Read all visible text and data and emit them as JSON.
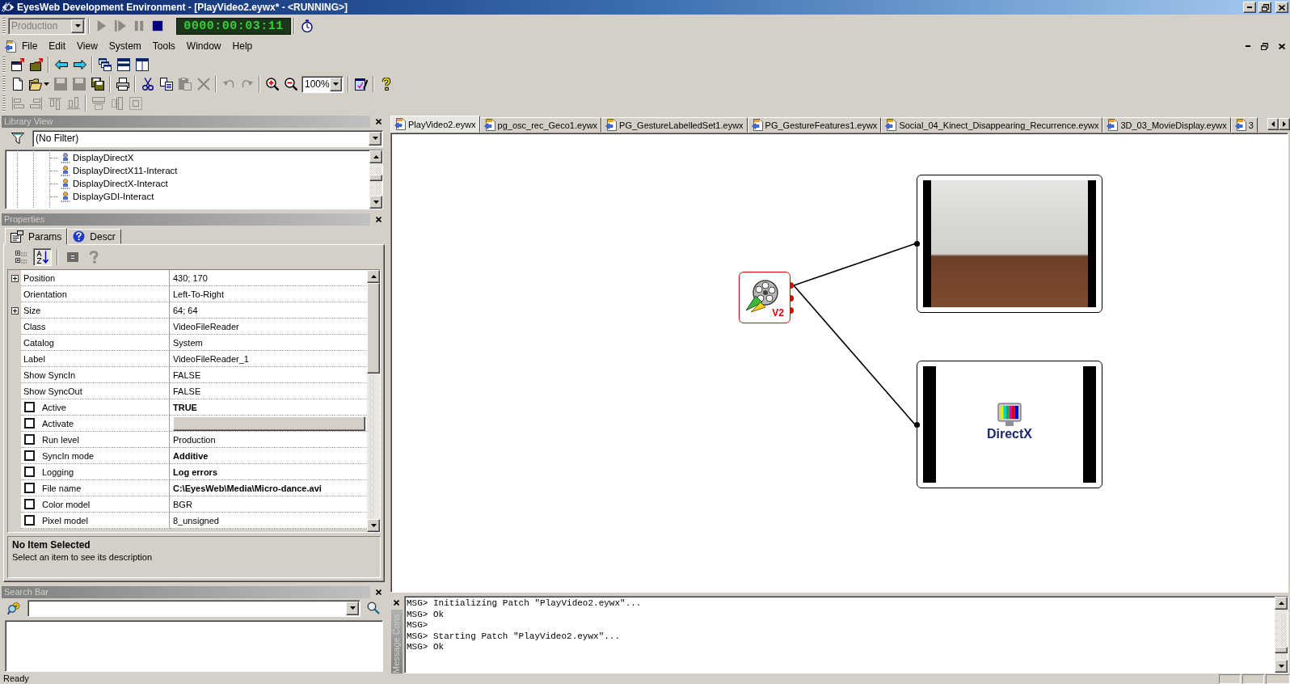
{
  "window": {
    "title": "EyesWeb Development Environment - [PlayVideo2.eywx* - <RUNNING>]"
  },
  "run_toolbar": {
    "run_level": {
      "value": "Production",
      "disabled": true
    },
    "controls": [
      {
        "kind": "play",
        "disabled": true
      },
      {
        "kind": "step",
        "disabled": true
      },
      {
        "kind": "pause",
        "disabled": true
      },
      {
        "kind": "stop",
        "disabled": false
      }
    ],
    "timer": "0000:00:03:11"
  },
  "menu": [
    "File",
    "Edit",
    "View",
    "System",
    "Tools",
    "Window",
    "Help"
  ],
  "toolbars": [
    {
      "groups": [
        [
          {
            "kind": "new-window",
            "disabled": false
          },
          {
            "kind": "open-window",
            "disabled": false
          }
        ],
        [
          {
            "kind": "back",
            "disabled": false
          },
          {
            "kind": "forward",
            "disabled": false
          }
        ],
        [
          {
            "kind": "cascade",
            "disabled": false
          },
          {
            "kind": "tile-horizontal",
            "disabled": false
          },
          {
            "kind": "tile-vertical",
            "disabled": false
          }
        ]
      ]
    },
    {
      "groups": [
        [
          {
            "kind": "new",
            "disabled": false
          },
          {
            "kind": "open",
            "disabled": false
          },
          {
            "kind": "save",
            "disabled": true
          },
          {
            "kind": "save-as",
            "disabled": true
          },
          {
            "kind": "save-all",
            "disabled": false
          }
        ],
        [
          {
            "kind": "print",
            "disabled": false
          }
        ],
        [
          {
            "kind": "cut",
            "disabled": false
          },
          {
            "kind": "copy",
            "disabled": false
          },
          {
            "kind": "paste",
            "disabled": true
          },
          {
            "kind": "delete",
            "disabled": true
          }
        ],
        [
          {
            "kind": "undo",
            "disabled": true
          },
          {
            "kind": "redo",
            "disabled": true
          }
        ],
        [
          {
            "kind": "zoom-in",
            "disabled": false
          },
          {
            "kind": "zoom-out",
            "disabled": false
          },
          {
            "kind": "zoom",
            "value": "100%",
            "disabled": false
          }
        ],
        [
          {
            "kind": "patch-properties",
            "disabled": false
          }
        ],
        [
          {
            "kind": "help",
            "disabled": false
          }
        ]
      ]
    },
    {
      "groups": [
        [
          {
            "kind": "align-left",
            "disabled": true
          },
          {
            "kind": "align-right",
            "disabled": true
          },
          {
            "kind": "align-top",
            "disabled": true
          },
          {
            "kind": "align-bottom",
            "disabled": true
          }
        ],
        [
          {
            "kind": "same-width",
            "disabled": true
          },
          {
            "kind": "same-height",
            "disabled": true
          },
          {
            "kind": "same-size",
            "disabled": true
          }
        ]
      ]
    }
  ],
  "library_view": {
    "title": "Library View",
    "filter": "(No Filter)",
    "items": [
      "DisplayDirectX",
      "DisplayDirectX11-Interact",
      "DisplayDirectX-Interact",
      "DisplayGDI-Interact"
    ]
  },
  "properties": {
    "title": "Properties",
    "tabs": [
      {
        "label": "Params",
        "selected": true
      },
      {
        "label": "Descr",
        "selected": false
      }
    ],
    "sort_modes": [
      {
        "kind": "categorized",
        "selected": false
      },
      {
        "kind": "alphabetic",
        "selected": true
      }
    ],
    "tools": [
      {
        "kind": "pages",
        "disabled": false
      },
      {
        "kind": "help",
        "disabled": true
      }
    ],
    "rows": [
      {
        "kind": "group",
        "name": "Position",
        "value": "430; 170",
        "expanded": false,
        "modified": false
      },
      {
        "kind": "field",
        "name": "Orientation",
        "value": "Left-To-Right",
        "modified": false
      },
      {
        "kind": "group",
        "name": "Size",
        "value": "64; 64",
        "expanded": false,
        "modified": false
      },
      {
        "kind": "field",
        "name": "Class",
        "value": "VideoFileReader",
        "modified": false
      },
      {
        "kind": "field",
        "name": "Catalog",
        "value": "System",
        "modified": false
      },
      {
        "kind": "field",
        "name": "Label",
        "value": "VideoFileReader_1",
        "modified": false
      },
      {
        "kind": "field",
        "name": "Show SyncIn",
        "value": "FALSE",
        "modified": false
      },
      {
        "kind": "field",
        "name": "Show SyncOut",
        "value": "FALSE",
        "modified": false
      },
      {
        "kind": "option",
        "name": "Active",
        "value": "TRUE",
        "checked": false,
        "modified": true
      },
      {
        "kind": "action",
        "name": "Activate",
        "checked": false
      },
      {
        "kind": "option",
        "name": "Run level",
        "value": "Production",
        "checked": false,
        "modified": false
      },
      {
        "kind": "option",
        "name": "SyncIn mode",
        "value": "Additive",
        "checked": false,
        "modified": true
      },
      {
        "kind": "option",
        "name": "Logging",
        "value": "Log errors",
        "checked": false,
        "modified": true
      },
      {
        "kind": "option",
        "name": "File name",
        "value": "C:\\EyesWeb\\Media\\Micro-dance.avi",
        "checked": false,
        "modified": true
      },
      {
        "kind": "option",
        "name": "Color model",
        "value": "BGR",
        "checked": false,
        "modified": false
      },
      {
        "kind": "option",
        "name": "Pixel model",
        "value": "8_unsigned",
        "checked": false,
        "modified": false
      }
    ],
    "description": {
      "title": "No Item Selected",
      "text": "Select an item to see its description"
    }
  },
  "search_bar": {
    "title": "Search Bar"
  },
  "document_tabs": [
    {
      "label": "PlayVideo2.eywx",
      "selected": true
    },
    {
      "label": "pg_osc_rec_Geco1.eywx",
      "selected": false
    },
    {
      "label": "PG_GestureLabelledSet1.eywx",
      "selected": false
    },
    {
      "label": "PG_GestureFeatures1.eywx",
      "selected": false
    },
    {
      "label": "Social_04_Kinect_Disappearing_Recurrence.eywx",
      "selected": false
    },
    {
      "label": "3D_03_MovieDisplay.eywx",
      "selected": false
    },
    {
      "label": "3",
      "selected": false
    }
  ],
  "canvas": {
    "nodes": [
      {
        "kind": "reader",
        "badge": "V2",
        "selected": true
      },
      {
        "kind": "video_display",
        "selected": false
      },
      {
        "kind": "directx_display",
        "label": "DirectX",
        "selected": false
      }
    ]
  },
  "console": {
    "title": "Message Cons",
    "lines": [
      "MSG> Initializing Patch \"PlayVideo2.eywx\"...",
      "MSG> Ok",
      "MSG>",
      "MSG> Starting Patch \"PlayVideo2.eywx\"...",
      "MSG> Ok"
    ]
  },
  "status_bar": {
    "text": "Ready"
  }
}
